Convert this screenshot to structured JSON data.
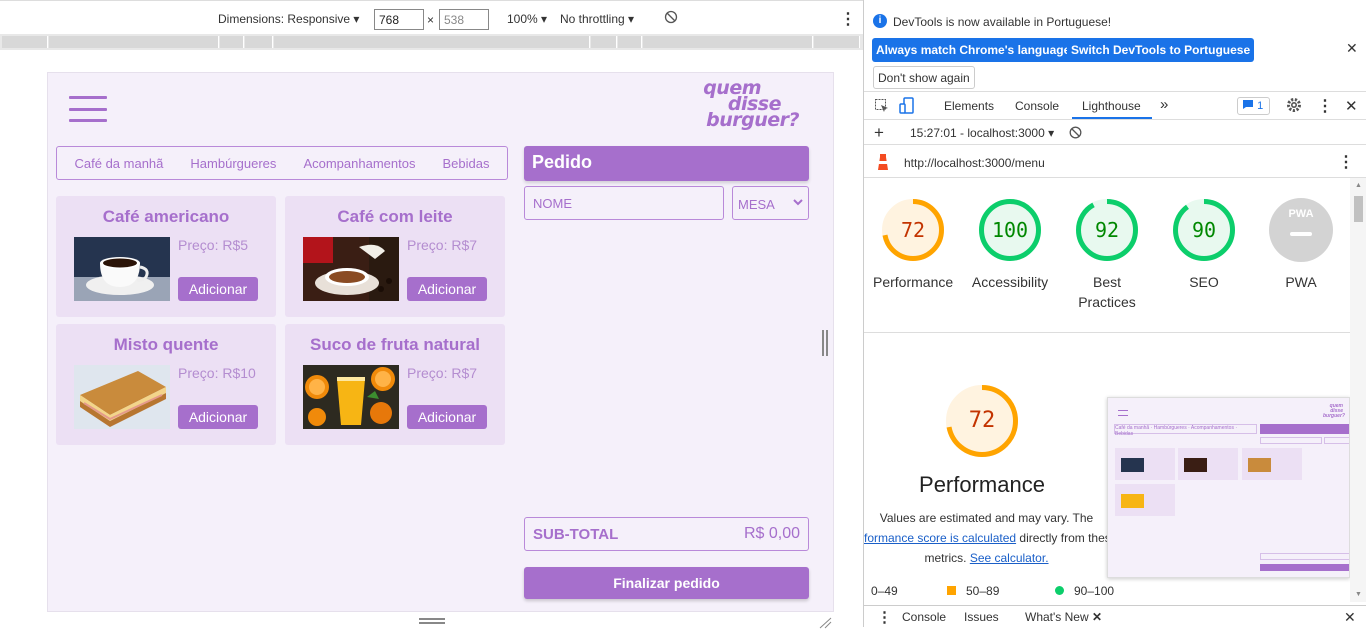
{
  "emulation": {
    "dimensions_label": "Dimensions: Responsive",
    "width": "768",
    "height": "538",
    "times": "×",
    "zoom": "100%",
    "throttling": "No throttling"
  },
  "app": {
    "logo_lines": [
      "quem",
      "disse",
      "burguer?"
    ],
    "categories": [
      "Café da manhã",
      "Hambúrgueres",
      "Acompanhamentos",
      "Bebidas"
    ],
    "products": [
      {
        "name": "Café americano",
        "price": "Preço: R$5",
        "button": "Adicionar"
      },
      {
        "name": "Café com leite",
        "price": "Preço: R$7",
        "button": "Adicionar"
      },
      {
        "name": "Misto quente",
        "price": "Preço: R$10",
        "button": "Adicionar"
      },
      {
        "name": "Suco de fruta natural",
        "price": "Preço: R$7",
        "button": "Adicionar"
      }
    ],
    "order": {
      "title": "Pedido",
      "name_placeholder": "NOME",
      "table_placeholder": "MESA",
      "subtotal_label": "SUB-TOTAL",
      "subtotal_value": "R$ 0,00",
      "finish_label": "Finalizar pedido"
    },
    "colors": {
      "accent": "#a66fcc",
      "background": "#f5f0fa",
      "card": "#ece0f4"
    }
  },
  "devtools": {
    "info": {
      "message": "DevTools is now available in Portuguese!",
      "btn_match": "Always match Chrome's language",
      "btn_switch": "Switch DevTools to Portuguese",
      "btn_dismiss": "Don't show again"
    },
    "tabs": [
      "Elements",
      "Console",
      "Lighthouse"
    ],
    "active_tab": "Lighthouse",
    "more_tabs": "»",
    "message_count": "1",
    "report_time": "15:27:01 - localhost:3000",
    "url": "http://localhost:3000/menu",
    "scores": [
      {
        "label": "Performance",
        "value": "72",
        "score": 72,
        "color": "#ffa400"
      },
      {
        "label": "Accessibility",
        "value": "100",
        "score": 100,
        "color": "#0cce6b"
      },
      {
        "label": "Best Practices",
        "value": "92",
        "score": 92,
        "color": "#0cce6b"
      },
      {
        "label": "SEO",
        "value": "90",
        "score": 90,
        "color": "#0cce6b"
      },
      {
        "label": "PWA",
        "value": "PWA",
        "score": 0,
        "color": "#c8c8c8"
      }
    ],
    "perf": {
      "score": "72",
      "title": "Performance",
      "desc_1": "Values are estimated and may vary. The",
      "desc_link": "formance score is calculated",
      "desc_2": " directly from thes",
      "desc_3": "metrics. ",
      "desc_link2": "See calculator.",
      "legend": [
        "0–49",
        "50–89",
        "90–100"
      ]
    },
    "drawer_tabs": [
      "Console",
      "Issues",
      "What's New"
    ]
  }
}
